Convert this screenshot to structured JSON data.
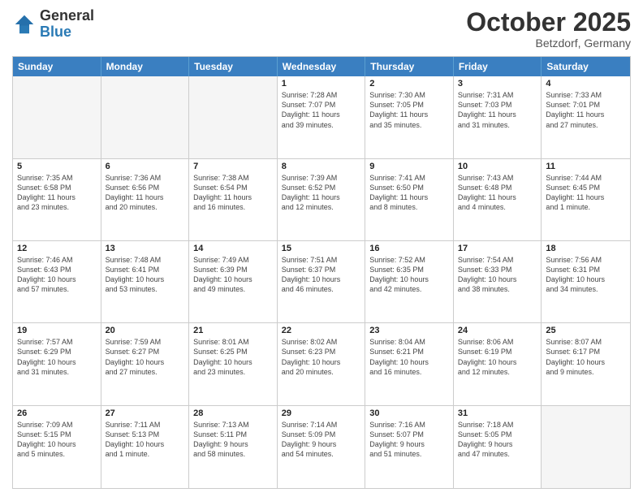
{
  "header": {
    "logo_general": "General",
    "logo_blue": "Blue",
    "title": "October 2025",
    "subtitle": "Betzdorf, Germany"
  },
  "weekdays": [
    "Sunday",
    "Monday",
    "Tuesday",
    "Wednesday",
    "Thursday",
    "Friday",
    "Saturday"
  ],
  "weeks": [
    [
      {
        "day": "",
        "info": ""
      },
      {
        "day": "",
        "info": ""
      },
      {
        "day": "",
        "info": ""
      },
      {
        "day": "1",
        "info": "Sunrise: 7:28 AM\nSunset: 7:07 PM\nDaylight: 11 hours\nand 39 minutes."
      },
      {
        "day": "2",
        "info": "Sunrise: 7:30 AM\nSunset: 7:05 PM\nDaylight: 11 hours\nand 35 minutes."
      },
      {
        "day": "3",
        "info": "Sunrise: 7:31 AM\nSunset: 7:03 PM\nDaylight: 11 hours\nand 31 minutes."
      },
      {
        "day": "4",
        "info": "Sunrise: 7:33 AM\nSunset: 7:01 PM\nDaylight: 11 hours\nand 27 minutes."
      }
    ],
    [
      {
        "day": "5",
        "info": "Sunrise: 7:35 AM\nSunset: 6:58 PM\nDaylight: 11 hours\nand 23 minutes."
      },
      {
        "day": "6",
        "info": "Sunrise: 7:36 AM\nSunset: 6:56 PM\nDaylight: 11 hours\nand 20 minutes."
      },
      {
        "day": "7",
        "info": "Sunrise: 7:38 AM\nSunset: 6:54 PM\nDaylight: 11 hours\nand 16 minutes."
      },
      {
        "day": "8",
        "info": "Sunrise: 7:39 AM\nSunset: 6:52 PM\nDaylight: 11 hours\nand 12 minutes."
      },
      {
        "day": "9",
        "info": "Sunrise: 7:41 AM\nSunset: 6:50 PM\nDaylight: 11 hours\nand 8 minutes."
      },
      {
        "day": "10",
        "info": "Sunrise: 7:43 AM\nSunset: 6:48 PM\nDaylight: 11 hours\nand 4 minutes."
      },
      {
        "day": "11",
        "info": "Sunrise: 7:44 AM\nSunset: 6:45 PM\nDaylight: 11 hours\nand 1 minute."
      }
    ],
    [
      {
        "day": "12",
        "info": "Sunrise: 7:46 AM\nSunset: 6:43 PM\nDaylight: 10 hours\nand 57 minutes."
      },
      {
        "day": "13",
        "info": "Sunrise: 7:48 AM\nSunset: 6:41 PM\nDaylight: 10 hours\nand 53 minutes."
      },
      {
        "day": "14",
        "info": "Sunrise: 7:49 AM\nSunset: 6:39 PM\nDaylight: 10 hours\nand 49 minutes."
      },
      {
        "day": "15",
        "info": "Sunrise: 7:51 AM\nSunset: 6:37 PM\nDaylight: 10 hours\nand 46 minutes."
      },
      {
        "day": "16",
        "info": "Sunrise: 7:52 AM\nSunset: 6:35 PM\nDaylight: 10 hours\nand 42 minutes."
      },
      {
        "day": "17",
        "info": "Sunrise: 7:54 AM\nSunset: 6:33 PM\nDaylight: 10 hours\nand 38 minutes."
      },
      {
        "day": "18",
        "info": "Sunrise: 7:56 AM\nSunset: 6:31 PM\nDaylight: 10 hours\nand 34 minutes."
      }
    ],
    [
      {
        "day": "19",
        "info": "Sunrise: 7:57 AM\nSunset: 6:29 PM\nDaylight: 10 hours\nand 31 minutes."
      },
      {
        "day": "20",
        "info": "Sunrise: 7:59 AM\nSunset: 6:27 PM\nDaylight: 10 hours\nand 27 minutes."
      },
      {
        "day": "21",
        "info": "Sunrise: 8:01 AM\nSunset: 6:25 PM\nDaylight: 10 hours\nand 23 minutes."
      },
      {
        "day": "22",
        "info": "Sunrise: 8:02 AM\nSunset: 6:23 PM\nDaylight: 10 hours\nand 20 minutes."
      },
      {
        "day": "23",
        "info": "Sunrise: 8:04 AM\nSunset: 6:21 PM\nDaylight: 10 hours\nand 16 minutes."
      },
      {
        "day": "24",
        "info": "Sunrise: 8:06 AM\nSunset: 6:19 PM\nDaylight: 10 hours\nand 12 minutes."
      },
      {
        "day": "25",
        "info": "Sunrise: 8:07 AM\nSunset: 6:17 PM\nDaylight: 10 hours\nand 9 minutes."
      }
    ],
    [
      {
        "day": "26",
        "info": "Sunrise: 7:09 AM\nSunset: 5:15 PM\nDaylight: 10 hours\nand 5 minutes."
      },
      {
        "day": "27",
        "info": "Sunrise: 7:11 AM\nSunset: 5:13 PM\nDaylight: 10 hours\nand 1 minute."
      },
      {
        "day": "28",
        "info": "Sunrise: 7:13 AM\nSunset: 5:11 PM\nDaylight: 9 hours\nand 58 minutes."
      },
      {
        "day": "29",
        "info": "Sunrise: 7:14 AM\nSunset: 5:09 PM\nDaylight: 9 hours\nand 54 minutes."
      },
      {
        "day": "30",
        "info": "Sunrise: 7:16 AM\nSunset: 5:07 PM\nDaylight: 9 hours\nand 51 minutes."
      },
      {
        "day": "31",
        "info": "Sunrise: 7:18 AM\nSunset: 5:05 PM\nDaylight: 9 hours\nand 47 minutes."
      },
      {
        "day": "",
        "info": ""
      }
    ]
  ]
}
